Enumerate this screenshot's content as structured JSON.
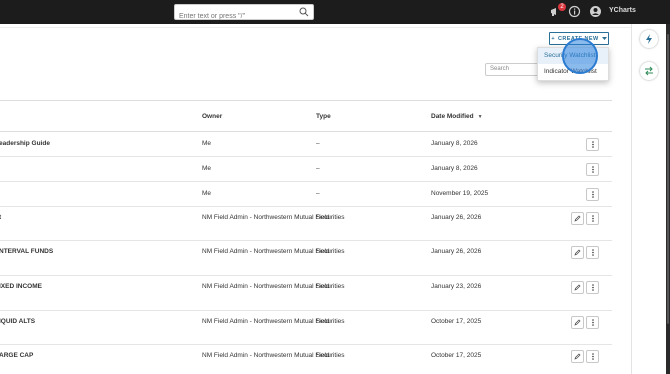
{
  "topbar": {
    "search_placeholder": "Enter text or press \"/\"",
    "notification_count": "2",
    "brand": "YCharts"
  },
  "toolbar": {
    "create_label": "CREATE NEW",
    "create_plus": "+",
    "dropdown": [
      "Security Watchlist",
      "Indicator Watchlist"
    ],
    "filter_search_placeholder": "Search"
  },
  "table": {
    "headers": {
      "owner": "Owner",
      "type": "Type",
      "date": "Date Modified"
    },
    "rows": [
      {
        "name": "eadership Guide",
        "owner": "Me",
        "type": "–",
        "date": "January 8, 2026"
      },
      {
        "name": "",
        "owner": "Me",
        "type": "–",
        "date": "January 8, 2026"
      },
      {
        "name": "",
        "owner": "Me",
        "type": "–",
        "date": "November 19, 2025"
      },
      {
        "name": "t",
        "owner": "NM Field Admin - Northwestern Mutual Field",
        "type": "Securities",
        "date": "January 26, 2026"
      },
      {
        "name": "NTERVAL FUNDS",
        "owner": "NM Field Admin - Northwestern Mutual Field",
        "type": "Securities",
        "date": "January 26, 2026"
      },
      {
        "name": "IXED INCOME",
        "owner": "NM Field Admin - Northwestern Mutual Field",
        "type": "Securities",
        "date": "January 23, 2026"
      },
      {
        "name": "IQUID ALTS",
        "owner": "NM Field Admin - Northwestern Mutual Field",
        "type": "Securities",
        "date": "October 17, 2025"
      },
      {
        "name": "ARGE CAP",
        "owner": "NM Field Admin - Northwestern Mutual Field",
        "type": "Securities",
        "date": "October 17, 2025"
      }
    ]
  },
  "colors": {
    "accent": "#2a6f97",
    "topbar": "#1c1c1c",
    "badge": "#d9363e"
  }
}
